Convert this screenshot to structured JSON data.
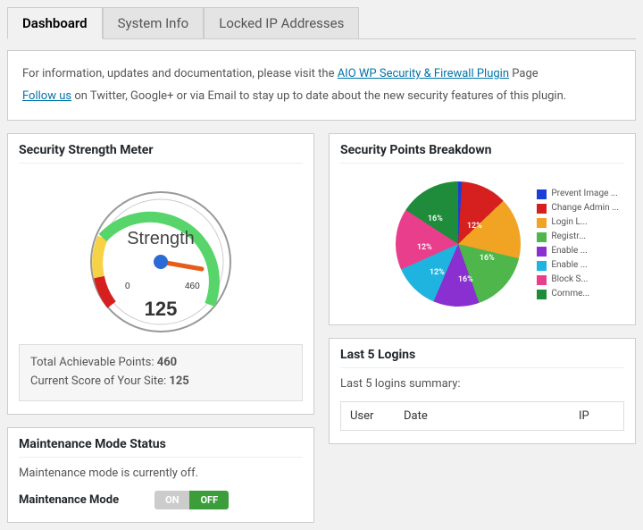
{
  "tabs": [
    "Dashboard",
    "System Info",
    "Locked IP Addresses"
  ],
  "active_tab": 0,
  "info": {
    "p1a": "For information, updates and documentation, please visit the ",
    "p1_link": "AIO WP Security & Firewall Plugin",
    "p1b": " Page",
    "p2_link": "Follow us",
    "p2b": " on Twitter, Google+ or via Email to stay up to date about the new security features of this plugin."
  },
  "strength": {
    "title": "Security Strength Meter",
    "gauge_label": "Strength",
    "min": "0",
    "max": "460",
    "score": "125",
    "stats_total_label": "Total Achievable Points: ",
    "stats_total_value": "460",
    "stats_current_label": "Current Score of Your Site: ",
    "stats_current_value": "125"
  },
  "breakdown": {
    "title": "Security Points Breakdown",
    "legend": [
      {
        "label": "Prevent Image ...",
        "color": "#1b3fd6"
      },
      {
        "label": "Change Admin ...",
        "color": "#d62020"
      },
      {
        "label": "Login L...",
        "color": "#f1a323"
      },
      {
        "label": "Registr...",
        "color": "#4fb64b"
      },
      {
        "label": "Enable ...",
        "color": "#8a2fd0"
      },
      {
        "label": "Enable ...",
        "color": "#1fb4e0"
      },
      {
        "label": "Block S...",
        "color": "#e83e8c"
      },
      {
        "label": "Comme...",
        "color": "#1e8c3a"
      }
    ],
    "slice_labels": [
      "12%",
      "16%",
      "16%",
      "12%",
      "12%",
      "16%"
    ]
  },
  "chart_data": {
    "type": "pie",
    "title": "Security Points Breakdown",
    "series": [
      {
        "name": "Prevent Image ...",
        "value": 1,
        "color": "#1b3fd6"
      },
      {
        "name": "Change Admin ...",
        "value": 12,
        "color": "#d62020"
      },
      {
        "name": "Login L...",
        "value": 16,
        "color": "#f1a323"
      },
      {
        "name": "Registr...",
        "value": 16,
        "color": "#4fb64b"
      },
      {
        "name": "Enable ...",
        "value": 12,
        "color": "#8a2fd0"
      },
      {
        "name": "Enable ...",
        "value": 12,
        "color": "#1fb4e0"
      },
      {
        "name": "Block S...",
        "value": 16,
        "color": "#e83e8c"
      },
      {
        "name": "Comme...",
        "value": 16,
        "color": "#1e8c3a"
      }
    ]
  },
  "maintenance": {
    "title": "Maintenance Mode Status",
    "status_text": "Maintenance mode is currently off.",
    "label": "Maintenance Mode",
    "on": "ON",
    "off": "OFF"
  },
  "logins": {
    "title": "Last 5 Logins",
    "summary": "Last 5 logins summary:",
    "cols": [
      "User",
      "Date",
      "IP"
    ]
  }
}
